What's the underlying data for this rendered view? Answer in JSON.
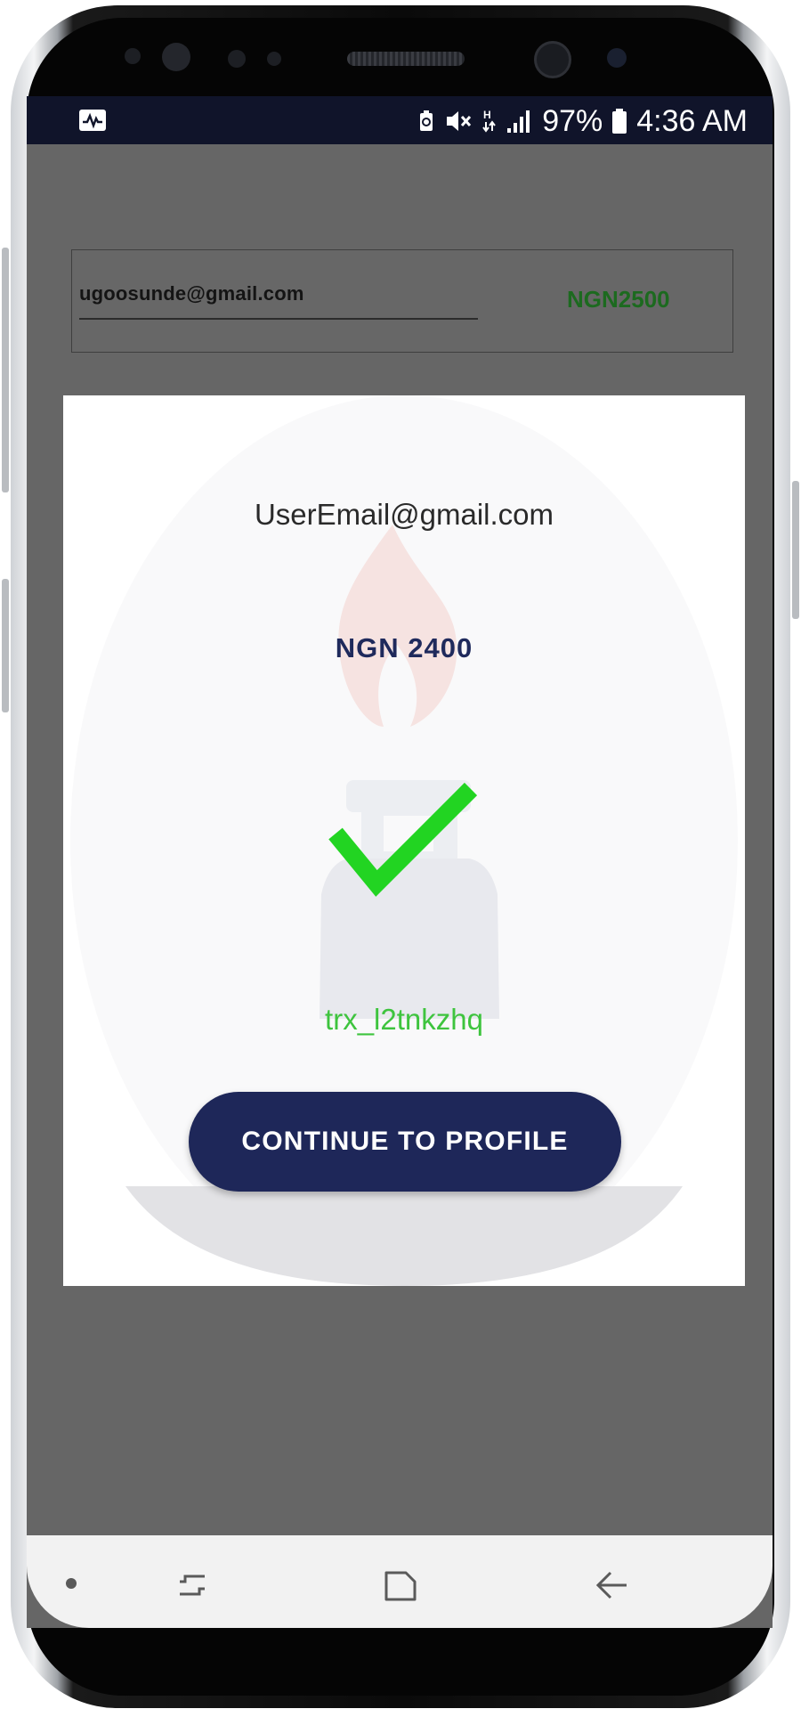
{
  "status_bar": {
    "battery": "97%",
    "time": "4:36 AM",
    "icons": [
      "activity-icon",
      "battery-saver-icon",
      "mute-icon",
      "network-h-icon",
      "signal-icon",
      "battery-icon"
    ]
  },
  "background_card": {
    "email": "ugoosunde@gmail.com",
    "amount": "NGN2500"
  },
  "modal": {
    "email": "UserEmail@gmail.com",
    "amount": "NGN 2400",
    "transaction_ref": "trx_l2tnkzhq",
    "continue_label": "CONTINUE TO PROFILE"
  },
  "nav_bar": {
    "icons": [
      "dot-icon",
      "recent-apps-icon",
      "home-icon",
      "back-icon"
    ]
  },
  "colors": {
    "brand_navy": "#1e2759",
    "success_green": "#22d422",
    "amount_green": "#1c6a1f",
    "trx_green": "#3ec43e"
  }
}
